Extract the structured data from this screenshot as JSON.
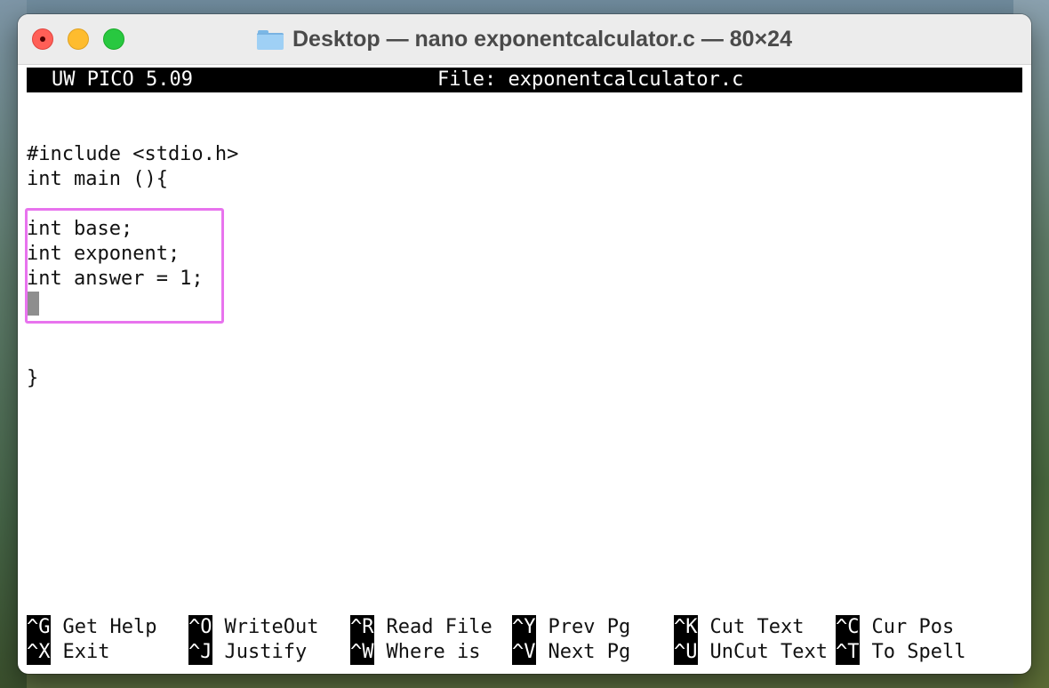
{
  "window": {
    "title": "Desktop — nano exponentcalculator.c — 80×24"
  },
  "editor": {
    "app_version": "UW PICO 5.09",
    "file_label": "File: exponentcalculator.c",
    "lines": [
      "#include <stdio.h>",
      "int main (){",
      "",
      "int base;",
      "int exponent;",
      "int answer = 1;",
      "",
      "",
      "",
      "}"
    ]
  },
  "shortcuts": {
    "row1": [
      {
        "key": "^G",
        "label": "Get Help"
      },
      {
        "key": "^O",
        "label": "WriteOut"
      },
      {
        "key": "^R",
        "label": "Read File"
      },
      {
        "key": "^Y",
        "label": "Prev Pg"
      },
      {
        "key": "^K",
        "label": "Cut Text"
      },
      {
        "key": "^C",
        "label": "Cur Pos"
      }
    ],
    "row2": [
      {
        "key": "^X",
        "label": "Exit"
      },
      {
        "key": "^J",
        "label": "Justify"
      },
      {
        "key": "^W",
        "label": "Where is"
      },
      {
        "key": "^V",
        "label": "Next Pg"
      },
      {
        "key": "^U",
        "label": "UnCut Text"
      },
      {
        "key": "^T",
        "label": "To Spell"
      }
    ]
  },
  "colors": {
    "highlight_box": "#e873ee",
    "terminal_bg": "#ffffff",
    "status_bar_bg": "#000000",
    "close_button": "#ff5f57",
    "minimize_button": "#febc2e",
    "zoom_button": "#28c840"
  },
  "icons": {
    "title_icon": "folder-icon"
  }
}
